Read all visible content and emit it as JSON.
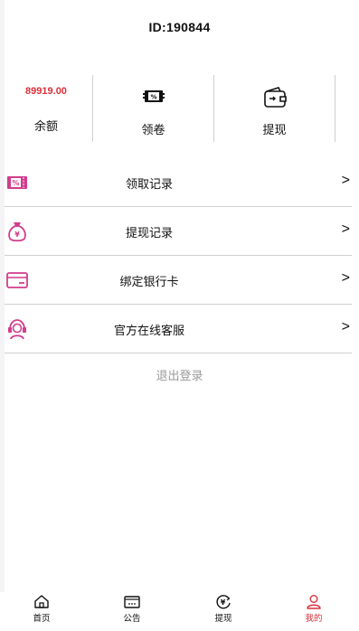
{
  "header": {
    "user_id": "ID:190844"
  },
  "stats": {
    "balance_value": "89919.00",
    "balance_label": "余额",
    "coupon_label": "领卷",
    "withdraw_label": "提现"
  },
  "menu": {
    "items": [
      {
        "label": "领取记录",
        "arrow": ">",
        "icon": "coupon-icon"
      },
      {
        "label": "提现记录",
        "arrow": ">",
        "icon": "money-bag-icon"
      },
      {
        "label": "绑定银行卡",
        "arrow": ">",
        "icon": "bank-card-icon"
      },
      {
        "label": "官方在线客服",
        "arrow": ">",
        "icon": "customer-service-icon"
      }
    ]
  },
  "logout_label": "退出登录",
  "tabbar": {
    "items": [
      {
        "label": "首页",
        "icon": "home-icon"
      },
      {
        "label": "公告",
        "icon": "notice-icon"
      },
      {
        "label": "提现",
        "icon": "yuan-icon"
      },
      {
        "label": "我的",
        "icon": "user-icon"
      }
    ],
    "active_index": 3
  },
  "colors": {
    "accent_red": "#d9303a",
    "icon_pink": "#d23c8c",
    "divider": "#cfcfcf",
    "muted": "#9a9a9a"
  }
}
